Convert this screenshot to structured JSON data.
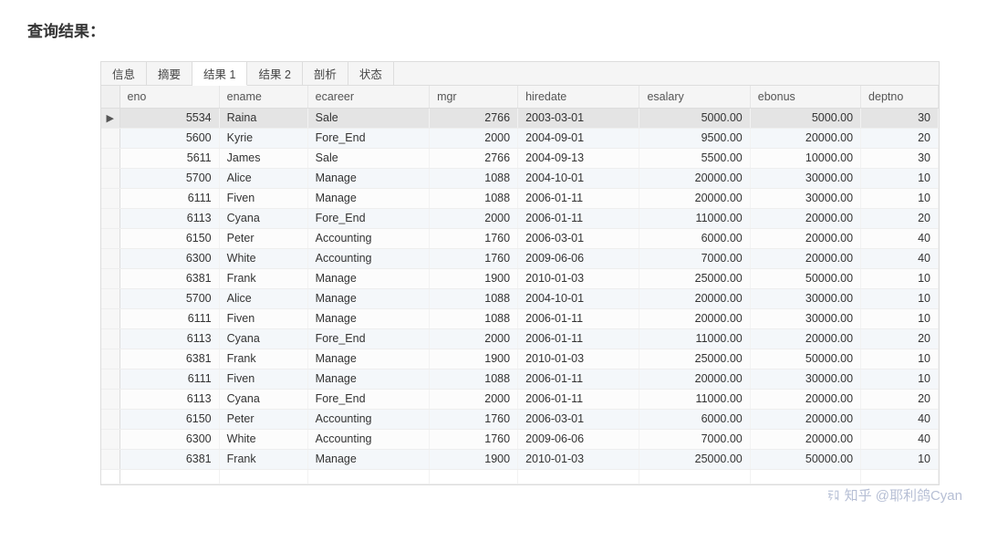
{
  "title": "查询结果：",
  "tabs": [
    {
      "label": "信息",
      "active": false
    },
    {
      "label": "摘要",
      "active": false
    },
    {
      "label": "结果 1",
      "active": true
    },
    {
      "label": "结果 2",
      "active": false
    },
    {
      "label": "剖析",
      "active": false
    },
    {
      "label": "状态",
      "active": false
    }
  ],
  "columns": [
    "eno",
    "ename",
    "ecareer",
    "mgr",
    "hiredate",
    "esalary",
    "ebonus",
    "deptno"
  ],
  "rows": [
    {
      "eno": "5534",
      "ename": "Raina",
      "ecareer": "Sale",
      "mgr": "2766",
      "hiredate": "2003-03-01",
      "esalary": "5000.00",
      "ebonus": "5000.00",
      "deptno": "30",
      "selected": true
    },
    {
      "eno": "5600",
      "ename": "Kyrie",
      "ecareer": "Fore_End",
      "mgr": "2000",
      "hiredate": "2004-09-01",
      "esalary": "9500.00",
      "ebonus": "20000.00",
      "deptno": "20"
    },
    {
      "eno": "5611",
      "ename": "James",
      "ecareer": "Sale",
      "mgr": "2766",
      "hiredate": "2004-09-13",
      "esalary": "5500.00",
      "ebonus": "10000.00",
      "deptno": "30"
    },
    {
      "eno": "5700",
      "ename": "Alice",
      "ecareer": "Manage",
      "mgr": "1088",
      "hiredate": "2004-10-01",
      "esalary": "20000.00",
      "ebonus": "30000.00",
      "deptno": "10"
    },
    {
      "eno": "6111",
      "ename": "Fiven",
      "ecareer": "Manage",
      "mgr": "1088",
      "hiredate": "2006-01-11",
      "esalary": "20000.00",
      "ebonus": "30000.00",
      "deptno": "10"
    },
    {
      "eno": "6113",
      "ename": "Cyana",
      "ecareer": "Fore_End",
      "mgr": "2000",
      "hiredate": "2006-01-11",
      "esalary": "11000.00",
      "ebonus": "20000.00",
      "deptno": "20"
    },
    {
      "eno": "6150",
      "ename": "Peter",
      "ecareer": "Accounting",
      "mgr": "1760",
      "hiredate": "2006-03-01",
      "esalary": "6000.00",
      "ebonus": "20000.00",
      "deptno": "40"
    },
    {
      "eno": "6300",
      "ename": "White",
      "ecareer": "Accounting",
      "mgr": "1760",
      "hiredate": "2009-06-06",
      "esalary": "7000.00",
      "ebonus": "20000.00",
      "deptno": "40"
    },
    {
      "eno": "6381",
      "ename": "Frank",
      "ecareer": "Manage",
      "mgr": "1900",
      "hiredate": "2010-01-03",
      "esalary": "25000.00",
      "ebonus": "50000.00",
      "deptno": "10"
    },
    {
      "eno": "5700",
      "ename": "Alice",
      "ecareer": "Manage",
      "mgr": "1088",
      "hiredate": "2004-10-01",
      "esalary": "20000.00",
      "ebonus": "30000.00",
      "deptno": "10"
    },
    {
      "eno": "6111",
      "ename": "Fiven",
      "ecareer": "Manage",
      "mgr": "1088",
      "hiredate": "2006-01-11",
      "esalary": "20000.00",
      "ebonus": "30000.00",
      "deptno": "10"
    },
    {
      "eno": "6113",
      "ename": "Cyana",
      "ecareer": "Fore_End",
      "mgr": "2000",
      "hiredate": "2006-01-11",
      "esalary": "11000.00",
      "ebonus": "20000.00",
      "deptno": "20"
    },
    {
      "eno": "6381",
      "ename": "Frank",
      "ecareer": "Manage",
      "mgr": "1900",
      "hiredate": "2010-01-03",
      "esalary": "25000.00",
      "ebonus": "50000.00",
      "deptno": "10"
    },
    {
      "eno": "6111",
      "ename": "Fiven",
      "ecareer": "Manage",
      "mgr": "1088",
      "hiredate": "2006-01-11",
      "esalary": "20000.00",
      "ebonus": "30000.00",
      "deptno": "10"
    },
    {
      "eno": "6113",
      "ename": "Cyana",
      "ecareer": "Fore_End",
      "mgr": "2000",
      "hiredate": "2006-01-11",
      "esalary": "11000.00",
      "ebonus": "20000.00",
      "deptno": "20"
    },
    {
      "eno": "6150",
      "ename": "Peter",
      "ecareer": "Accounting",
      "mgr": "1760",
      "hiredate": "2006-03-01",
      "esalary": "6000.00",
      "ebonus": "20000.00",
      "deptno": "40"
    },
    {
      "eno": "6300",
      "ename": "White",
      "ecareer": "Accounting",
      "mgr": "1760",
      "hiredate": "2009-06-06",
      "esalary": "7000.00",
      "ebonus": "20000.00",
      "deptno": "40"
    },
    {
      "eno": "6381",
      "ename": "Frank",
      "ecareer": "Manage",
      "mgr": "1900",
      "hiredate": "2010-01-03",
      "esalary": "25000.00",
      "ebonus": "50000.00",
      "deptno": "10"
    }
  ],
  "watermark": "知乎 @耶利鸽Cyan"
}
